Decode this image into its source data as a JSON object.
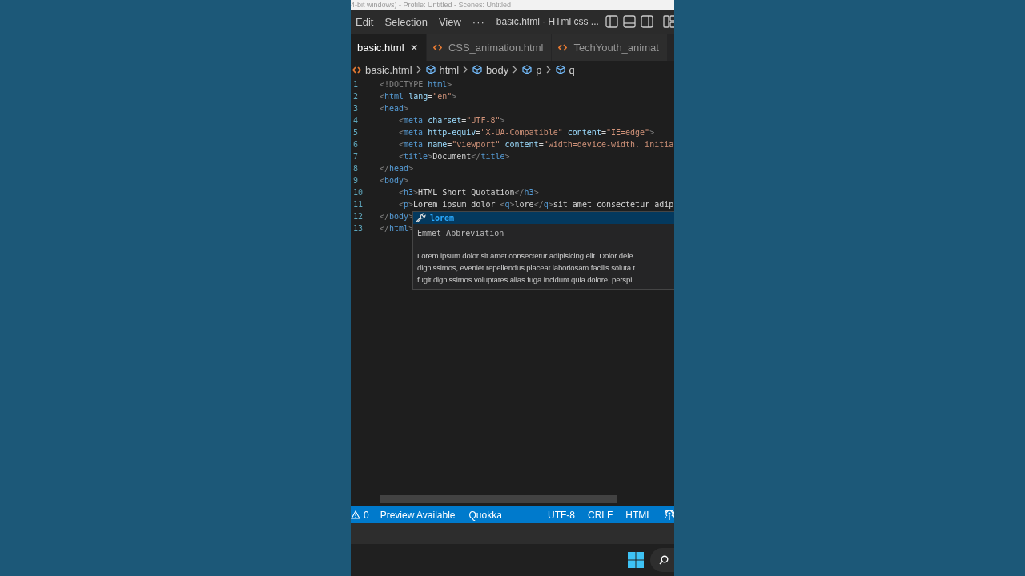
{
  "recorder_title": "4-bit windows) - Profile: Untitled - Scenes: Untitled",
  "title_bar": {
    "menus": [
      "Edit",
      "Selection",
      "View"
    ],
    "more": "···",
    "title": "basic.html - HTml css ..."
  },
  "tabs": [
    {
      "label": "basic.html",
      "selected": true,
      "close": "×"
    },
    {
      "label": "CSS_animation.html",
      "selected": false
    },
    {
      "label": "TechYouth_animat",
      "selected": false
    }
  ],
  "breadcrumb": [
    "basic.html",
    "html",
    "body",
    "p",
    "q"
  ],
  "code_lines": [
    {
      "number": "1",
      "indented": false,
      "tokens": [
        {
          "kind": "bracket",
          "text": "<!DOCTYPE "
        },
        {
          "kind": "tag",
          "text": "html"
        },
        {
          "kind": "bracket",
          "text": ">"
        }
      ]
    },
    {
      "number": "2",
      "indented": false,
      "tokens": [
        {
          "kind": "bracket",
          "text": "<"
        },
        {
          "kind": "tag",
          "text": "html "
        },
        {
          "kind": "attr",
          "text": "lang"
        },
        {
          "kind": "text",
          "text": "="
        },
        {
          "kind": "str",
          "text": "\"en\""
        },
        {
          "kind": "bracket",
          "text": ">"
        }
      ]
    },
    {
      "number": "3",
      "indented": false,
      "tokens": [
        {
          "kind": "bracket",
          "text": "<"
        },
        {
          "kind": "tag",
          "text": "head"
        },
        {
          "kind": "bracket",
          "text": ">"
        }
      ]
    },
    {
      "number": "4",
      "indented": true,
      "tokens": [
        {
          "kind": "bracket",
          "text": "<"
        },
        {
          "kind": "tag",
          "text": "meta "
        },
        {
          "kind": "attr",
          "text": "charset"
        },
        {
          "kind": "text",
          "text": "="
        },
        {
          "kind": "str",
          "text": "\"UTF-8\""
        },
        {
          "kind": "bracket",
          "text": ">"
        }
      ]
    },
    {
      "number": "5",
      "indented": true,
      "tokens": [
        {
          "kind": "bracket",
          "text": "<"
        },
        {
          "kind": "tag",
          "text": "meta "
        },
        {
          "kind": "attr",
          "text": "http-equiv"
        },
        {
          "kind": "text",
          "text": "="
        },
        {
          "kind": "str",
          "text": "\"X-UA-Compatible\" "
        },
        {
          "kind": "attr",
          "text": "content"
        },
        {
          "kind": "text",
          "text": "="
        },
        {
          "kind": "str",
          "text": "\"IE=edge\""
        },
        {
          "kind": "bracket",
          "text": ">"
        }
      ]
    },
    {
      "number": "6",
      "indented": true,
      "tokens": [
        {
          "kind": "bracket",
          "text": "<"
        },
        {
          "kind": "tag",
          "text": "meta "
        },
        {
          "kind": "attr",
          "text": "name"
        },
        {
          "kind": "text",
          "text": "="
        },
        {
          "kind": "str",
          "text": "\"viewport\" "
        },
        {
          "kind": "attr",
          "text": "content"
        },
        {
          "kind": "text",
          "text": "="
        },
        {
          "kind": "str",
          "text": "\"width=device-width, initia"
        }
      ]
    },
    {
      "number": "7",
      "indented": true,
      "tokens": [
        {
          "kind": "bracket",
          "text": "<"
        },
        {
          "kind": "tag",
          "text": "title"
        },
        {
          "kind": "bracket",
          "text": ">"
        },
        {
          "kind": "text",
          "text": "Document"
        },
        {
          "kind": "bracket",
          "text": "</"
        },
        {
          "kind": "tag",
          "text": "title"
        },
        {
          "kind": "bracket",
          "text": ">"
        }
      ]
    },
    {
      "number": "8",
      "indented": false,
      "tokens": [
        {
          "kind": "bracket",
          "text": "</"
        },
        {
          "kind": "tag",
          "text": "head"
        },
        {
          "kind": "bracket",
          "text": ">"
        }
      ]
    },
    {
      "number": "9",
      "indented": false,
      "tokens": [
        {
          "kind": "bracket",
          "text": "<"
        },
        {
          "kind": "tag",
          "text": "body"
        },
        {
          "kind": "bracket",
          "text": ">"
        }
      ]
    },
    {
      "number": "10",
      "indented": true,
      "tokens": [
        {
          "kind": "bracket",
          "text": "<"
        },
        {
          "kind": "tag",
          "text": "h3"
        },
        {
          "kind": "bracket",
          "text": ">"
        },
        {
          "kind": "text",
          "text": "HTML Short Quotation"
        },
        {
          "kind": "bracket",
          "text": "</"
        },
        {
          "kind": "tag",
          "text": "h3"
        },
        {
          "kind": "bracket",
          "text": ">"
        }
      ]
    },
    {
      "number": "11",
      "indented": true,
      "tokens": [
        {
          "kind": "bracket",
          "text": "<"
        },
        {
          "kind": "tag",
          "text": "p"
        },
        {
          "kind": "bracket",
          "text": ">"
        },
        {
          "kind": "text",
          "text": "Lorem ipsum dolor "
        },
        {
          "kind": "bracket",
          "text": "<"
        },
        {
          "kind": "tag",
          "text": "q"
        },
        {
          "kind": "bracket",
          "text": ">"
        },
        {
          "kind": "text",
          "text": "lore"
        },
        {
          "kind": "bracket",
          "text": "</"
        },
        {
          "kind": "tag",
          "text": "q"
        },
        {
          "kind": "bracket",
          "text": ">"
        },
        {
          "kind": "text",
          "text": "sit amet consectetur adip"
        }
      ]
    },
    {
      "number": "12",
      "indented": false,
      "tokens": [
        {
          "kind": "bracket",
          "text": "</"
        },
        {
          "kind": "tag",
          "text": "body"
        },
        {
          "kind": "bracket",
          "text": ">"
        }
      ]
    },
    {
      "number": "13",
      "indented": false,
      "tokens": [
        {
          "kind": "bracket",
          "text": "</"
        },
        {
          "kind": "tag",
          "text": "html"
        },
        {
          "kind": "bracket",
          "text": ">"
        }
      ]
    }
  ],
  "suggestion": {
    "label": "lorem",
    "detail": "Emmet Abbreviation",
    "doc_lines": [
      "Lorem ipsum dolor sit amet consectetur adipisicing elit. Dolor dele",
      "dignissimos, eveniet repellendus placeat laboriosam facilis soluta t",
      "fugit dignissimos voluptates alias fuga incidunt quia dolore, perspi"
    ]
  },
  "status_bar": {
    "warnings": "0",
    "items": [
      "Preview Available",
      "Quokka"
    ],
    "right_items": [
      "UTF-8",
      "CRLF",
      "HTML"
    ]
  }
}
